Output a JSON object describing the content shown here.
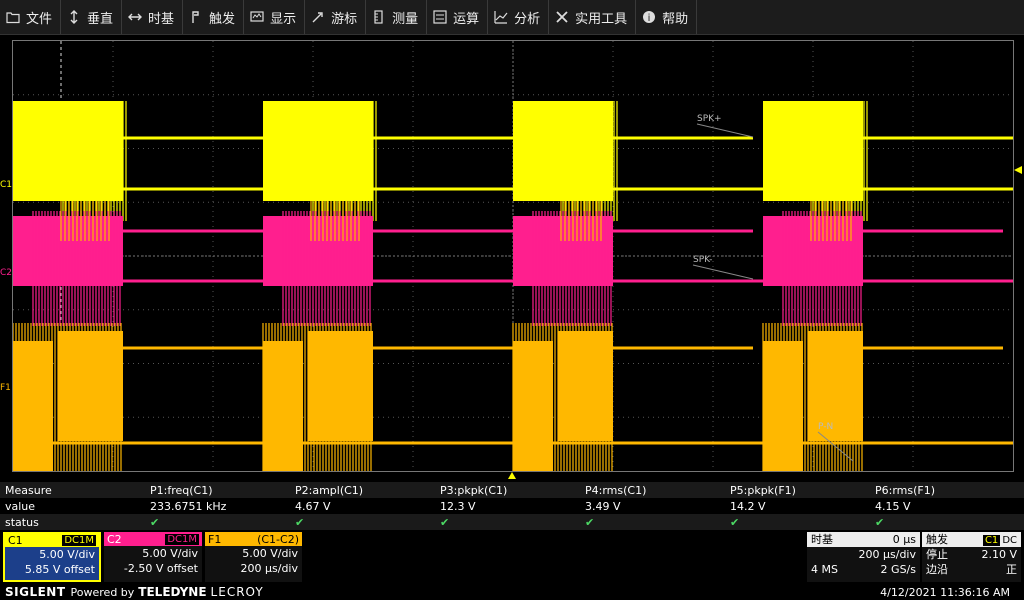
{
  "menu": [
    {
      "label": "文件",
      "icon": "folder-icon"
    },
    {
      "label": "垂直",
      "icon": "vertical-arrows-icon"
    },
    {
      "label": "时基",
      "icon": "horizontal-arrows-icon"
    },
    {
      "label": "触发",
      "icon": "trigger-flag-icon"
    },
    {
      "label": "显示",
      "icon": "display-icon"
    },
    {
      "label": "游标",
      "icon": "cursor-icon"
    },
    {
      "label": "测量",
      "icon": "measure-icon"
    },
    {
      "label": "运算",
      "icon": "math-icon"
    },
    {
      "label": "分析",
      "icon": "analysis-chart-icon"
    },
    {
      "label": "实用工具",
      "icon": "tools-icon"
    },
    {
      "label": "帮助",
      "icon": "help-icon"
    }
  ],
  "traces": {
    "c1_label": "C1",
    "c2_label": "C2",
    "f1_label": "F1",
    "spk_plus": "SPK+",
    "spk_minus": "SPK-",
    "pn": "P-N",
    "colors": {
      "c1": "#ffff00",
      "c2": "#ff1f8e",
      "f1": "#ffb800"
    }
  },
  "measure": {
    "row_labels": [
      "Measure",
      "value",
      "status"
    ],
    "params": [
      {
        "name": "P1:freq(C1)",
        "value": "233.6751 kHz",
        "status": "✔"
      },
      {
        "name": "P2:ampl(C1)",
        "value": "4.67 V",
        "status": "✔"
      },
      {
        "name": "P3:pkpk(C1)",
        "value": "12.3 V",
        "status": "✔"
      },
      {
        "name": "P4:rms(C1)",
        "value": "3.49 V",
        "status": "✔"
      },
      {
        "name": "P5:pkpk(F1)",
        "value": "14.2 V",
        "status": "✔"
      },
      {
        "name": "P6:rms(F1)",
        "value": "4.15 V",
        "status": "✔"
      }
    ]
  },
  "channels": {
    "c1": {
      "name": "C1",
      "coupling": "DC1M",
      "vdiv": "5.00 V/div",
      "offset": "5.85 V offset"
    },
    "c2": {
      "name": "C2",
      "coupling": "DC1M",
      "vdiv": "5.00 V/div",
      "offset": "-2.50 V offset"
    },
    "f1": {
      "name": "F1",
      "expr": "(C1-C2)",
      "vdiv": "5.00 V/div",
      "tdiv": "200 µs/div"
    }
  },
  "timebase": {
    "title": "时基",
    "delay": "0 µs",
    "tdiv": "200 µs/div",
    "points": "4 MS",
    "rate": "2 GS/s"
  },
  "trigger": {
    "title": "触发",
    "src": "C1",
    "coupling": "DC",
    "mode": "停止",
    "level": "2.10 V",
    "type": "边沿",
    "slope": "正"
  },
  "footer": {
    "brand": "SIGLENT",
    "powered": "Powered by",
    "teledyne": "TELEDYNE",
    "lecroy": "LECROY",
    "datetime": "4/12/2021 11:36:16 AM"
  }
}
